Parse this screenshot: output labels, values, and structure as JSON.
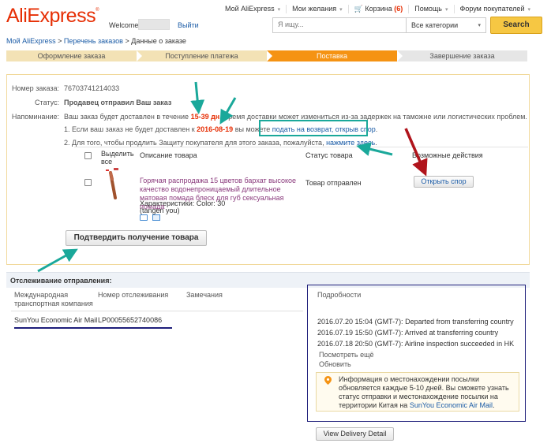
{
  "header": {
    "logo": "AliExpress",
    "welcome": "Welcome",
    "logout": "Выйти",
    "nav": [
      {
        "label": "Мой AliExpress",
        "caret": true
      },
      {
        "label": "Мои желания",
        "caret": true
      },
      {
        "label": "Корзина",
        "count": "(6)",
        "caret": false
      },
      {
        "label": "Помощь",
        "caret": true
      },
      {
        "label": "Форум покупателей",
        "caret": true
      }
    ],
    "search_placeholder": "Я ищу...",
    "category": "Все категории",
    "search_button": "Search"
  },
  "breadcrumb": {
    "link1": "Мой AliExpress",
    "link2": "Перечень заказов",
    "current": "Данные о заказе"
  },
  "steps": [
    "Оформление заказа",
    "Поступление платежа",
    "Поставка",
    "Завершение заказа"
  ],
  "order": {
    "number_label": "Номер заказа:",
    "number": "76703741214033",
    "status_label": "Статус:",
    "status": "Продавец отправил Ваш заказ",
    "reminder_label": "Напоминание:",
    "reminder_pre": "Ваш заказ будет доставлен в течение ",
    "reminder_days": "15-39 дн.",
    "reminder_post": " Время доставки может измениться из-за задержек на таможне или логистических проблем.",
    "note1_pre": "1. Если ваш заказ не будет доставлен к ",
    "note1_date": "2016-08-19",
    "note1_mid": " вы можете ",
    "note1_link": "подать на возврат, открыв спор",
    "note1_post": ".",
    "note2_pre": "2. Для того, чтобы продлить Защиту покупателя для этого заказа, пожалуйста, ",
    "note2_link": "нажмите здесь",
    "note2_post": "."
  },
  "table": {
    "col_select": "Выделить все",
    "col_desc": "Описание товара",
    "col_status": "Статус товара",
    "col_actions": "Возможные действия",
    "item": {
      "title": "Горячая распродажа 15 цветов бархат высокое качество водонепроницаемый длительное матовая помада блеск для губ сексуальная помада",
      "props": "Характеристики: Color: 30",
      "seller": "(tangen you)",
      "status": "Товар отправлен",
      "action": "Открыть спор"
    },
    "confirm_button": "Подтвердить получение товара"
  },
  "tracking": {
    "title": "Отслеживание отправления:",
    "col_company": "Международная транспортная компания",
    "col_number": "Номер отслеживания",
    "col_notes": "Замечания",
    "col_details": "Подробности",
    "company": "SunYou Economic Air Mail",
    "number": "LP00055652740086",
    "events": [
      "2016.07.20 15:04 (GMT-7): Departed from transferring country",
      "2016.07.19 15:50 (GMT-7): Arrived at transferring country",
      "2016.07.18 20:50 (GMT-7): Airline inspection succeeded in HK"
    ],
    "see_more": "Посмотреть ещё",
    "refresh": "Обновить",
    "info_text": "Информация о местонахождении посылки обновляется каждые 5-10 дней. Вы сможете узнать статус отправки и местонахождение посылки на территории Китая на",
    "info_link": "SunYou Economic Air Mail",
    "info_post": ".",
    "view_button": "View Delivery Detail"
  },
  "colors": {
    "brand": "#e62e04",
    "active_step": "#f59313",
    "annotation_arrow_teal": "#1aa89a",
    "annotation_arrow_red": "#b0141c",
    "annotation_box_navy": "#1e1e7a"
  }
}
